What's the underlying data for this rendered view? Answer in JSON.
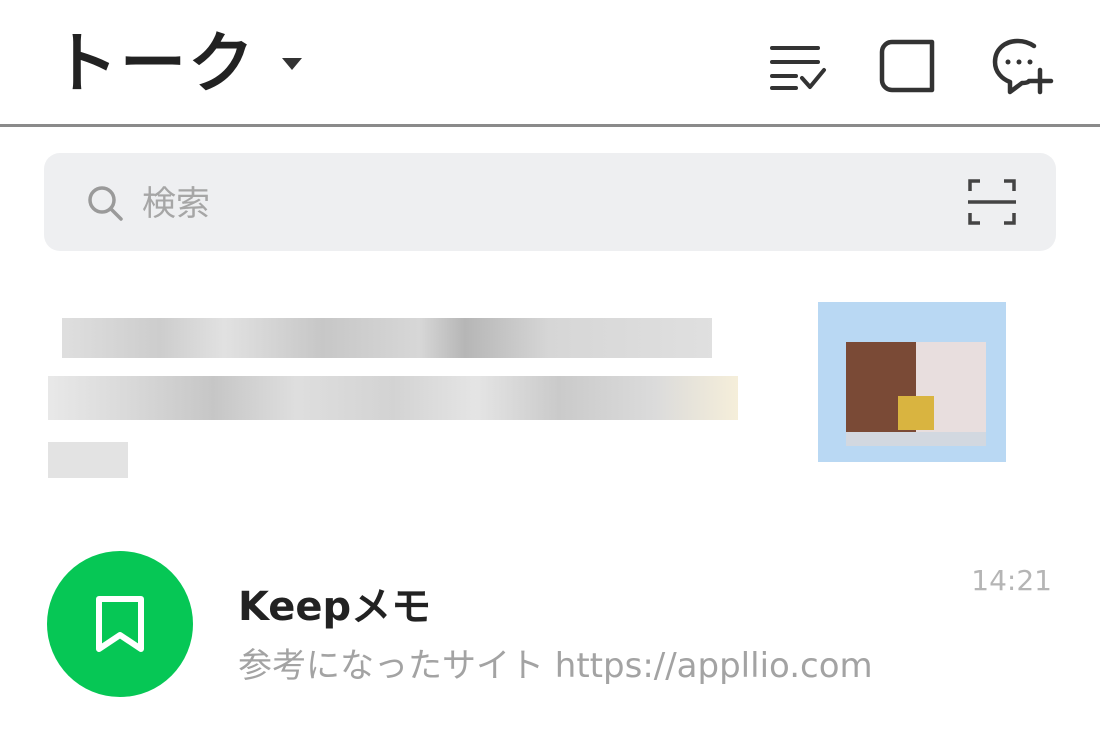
{
  "header": {
    "title": "トーク",
    "icons": [
      "edit-list-icon",
      "square-speech-icon",
      "new-chat-icon"
    ]
  },
  "search": {
    "placeholder": "検索"
  },
  "chats": [
    {
      "name": "Keepメモ",
      "preview": "参考になったサイト https://appllio.com",
      "time": "14:21",
      "avatar_color": "#06c755",
      "avatar_icon": "bookmark-icon"
    }
  ],
  "colors": {
    "accent_green": "#06c755",
    "search_bg": "#eeeff1",
    "divider": "#8a8a8a"
  }
}
